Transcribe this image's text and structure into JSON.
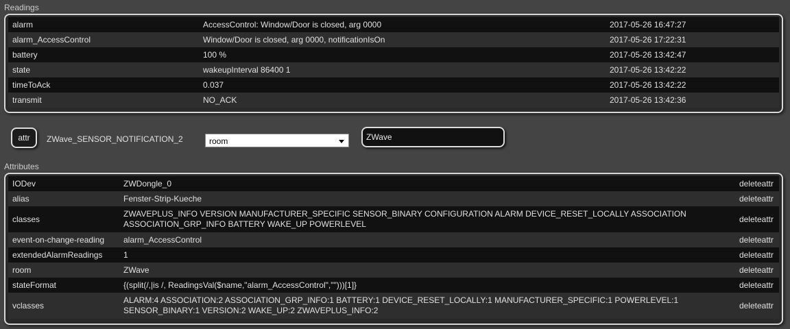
{
  "readings_section": {
    "title": "Readings",
    "rows": [
      {
        "name": "alarm",
        "value": "AccessControl: Window/Door is closed, arg 0000",
        "time": "2017-05-26 16:47:27"
      },
      {
        "name": "alarm_AccessControl",
        "value": "Window/Door is closed, arg 0000, notificationIsOn",
        "time": "2017-05-26 17:22:31"
      },
      {
        "name": "battery",
        "value": "100 %",
        "time": "2017-05-26 13:42:47"
      },
      {
        "name": "state",
        "value": "wakeupInterval 86400 1",
        "time": "2017-05-26 13:42:22"
      },
      {
        "name": "timeToAck",
        "value": "0.037",
        "time": "2017-05-26 13:42:22"
      },
      {
        "name": "transmit",
        "value": "NO_ACK",
        "time": "2017-05-26 13:42:36"
      }
    ]
  },
  "attr_control": {
    "button_label": "attr",
    "device_name": "ZWave_SENSOR_NOTIFICATION_2",
    "select_value": "room",
    "input_value": "ZWave"
  },
  "attributes_section": {
    "title": "Attributes",
    "delete_label": "deleteattr",
    "rows": [
      {
        "name": "IODev",
        "value": "ZWDongle_0"
      },
      {
        "name": "alias",
        "value": "Fenster-Strip-Kueche"
      },
      {
        "name": "classes",
        "value": "ZWAVEPLUS_INFO VERSION MANUFACTURER_SPECIFIC SENSOR_BINARY CONFIGURATION ALARM DEVICE_RESET_LOCALLY ASSOCIATION ASSOCIATION_GRP_INFO BATTERY WAKE_UP POWERLEVEL"
      },
      {
        "name": "event-on-change-reading",
        "value": "alarm_AccessControl"
      },
      {
        "name": "extendedAlarmReadings",
        "value": "1"
      },
      {
        "name": "room",
        "value": "ZWave"
      },
      {
        "name": "stateFormat",
        "value": "{(split(/,|is /, ReadingsVal($name,\"alarm_AccessControl\",\"\")))[1]}"
      },
      {
        "name": "vclasses",
        "value": "ALARM:4 ASSOCIATION:2 ASSOCIATION_GRP_INFO:1 BATTERY:1 DEVICE_RESET_LOCALLY:1 MANUFACTURER_SPECIFIC:1 POWERLEVEL:1 SENSOR_BINARY:1 VERSION:2 WAKE_UP:2 ZWAVEPLUS_INFO:2"
      }
    ]
  }
}
